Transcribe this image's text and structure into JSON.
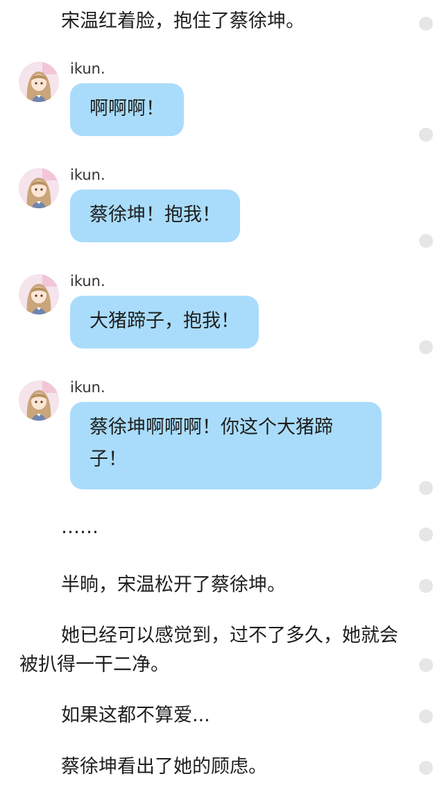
{
  "story": {
    "line1": "宋温红着脸，抱住了蔡徐坤。",
    "ellipsis": "……",
    "line2": "半晌，宋温松开了蔡徐坤。",
    "line3": "她已经可以感觉到，过不了多久，她就会被扒得一干二净。",
    "line4": "如果这都不算爱...",
    "line5": "蔡徐坤看出了她的顾虑。"
  },
  "chat": [
    {
      "name": "ikun.",
      "text": "啊啊啊！"
    },
    {
      "name": "ikun.",
      "text": "蔡徐坤！抱我！"
    },
    {
      "name": "ikun.",
      "text": "大猪蹄子，抱我！"
    },
    {
      "name": "ikun.",
      "text": "蔡徐坤啊啊啊！你这个大猪蹄子！"
    }
  ],
  "icons": {
    "avatar": "anime-girl-avatar-icon",
    "comment_dot": "comment-dot-icon"
  },
  "colors": {
    "bubble": "#a9dcfb",
    "text": "#1e1e1e",
    "dot": "#e6e6e6"
  }
}
